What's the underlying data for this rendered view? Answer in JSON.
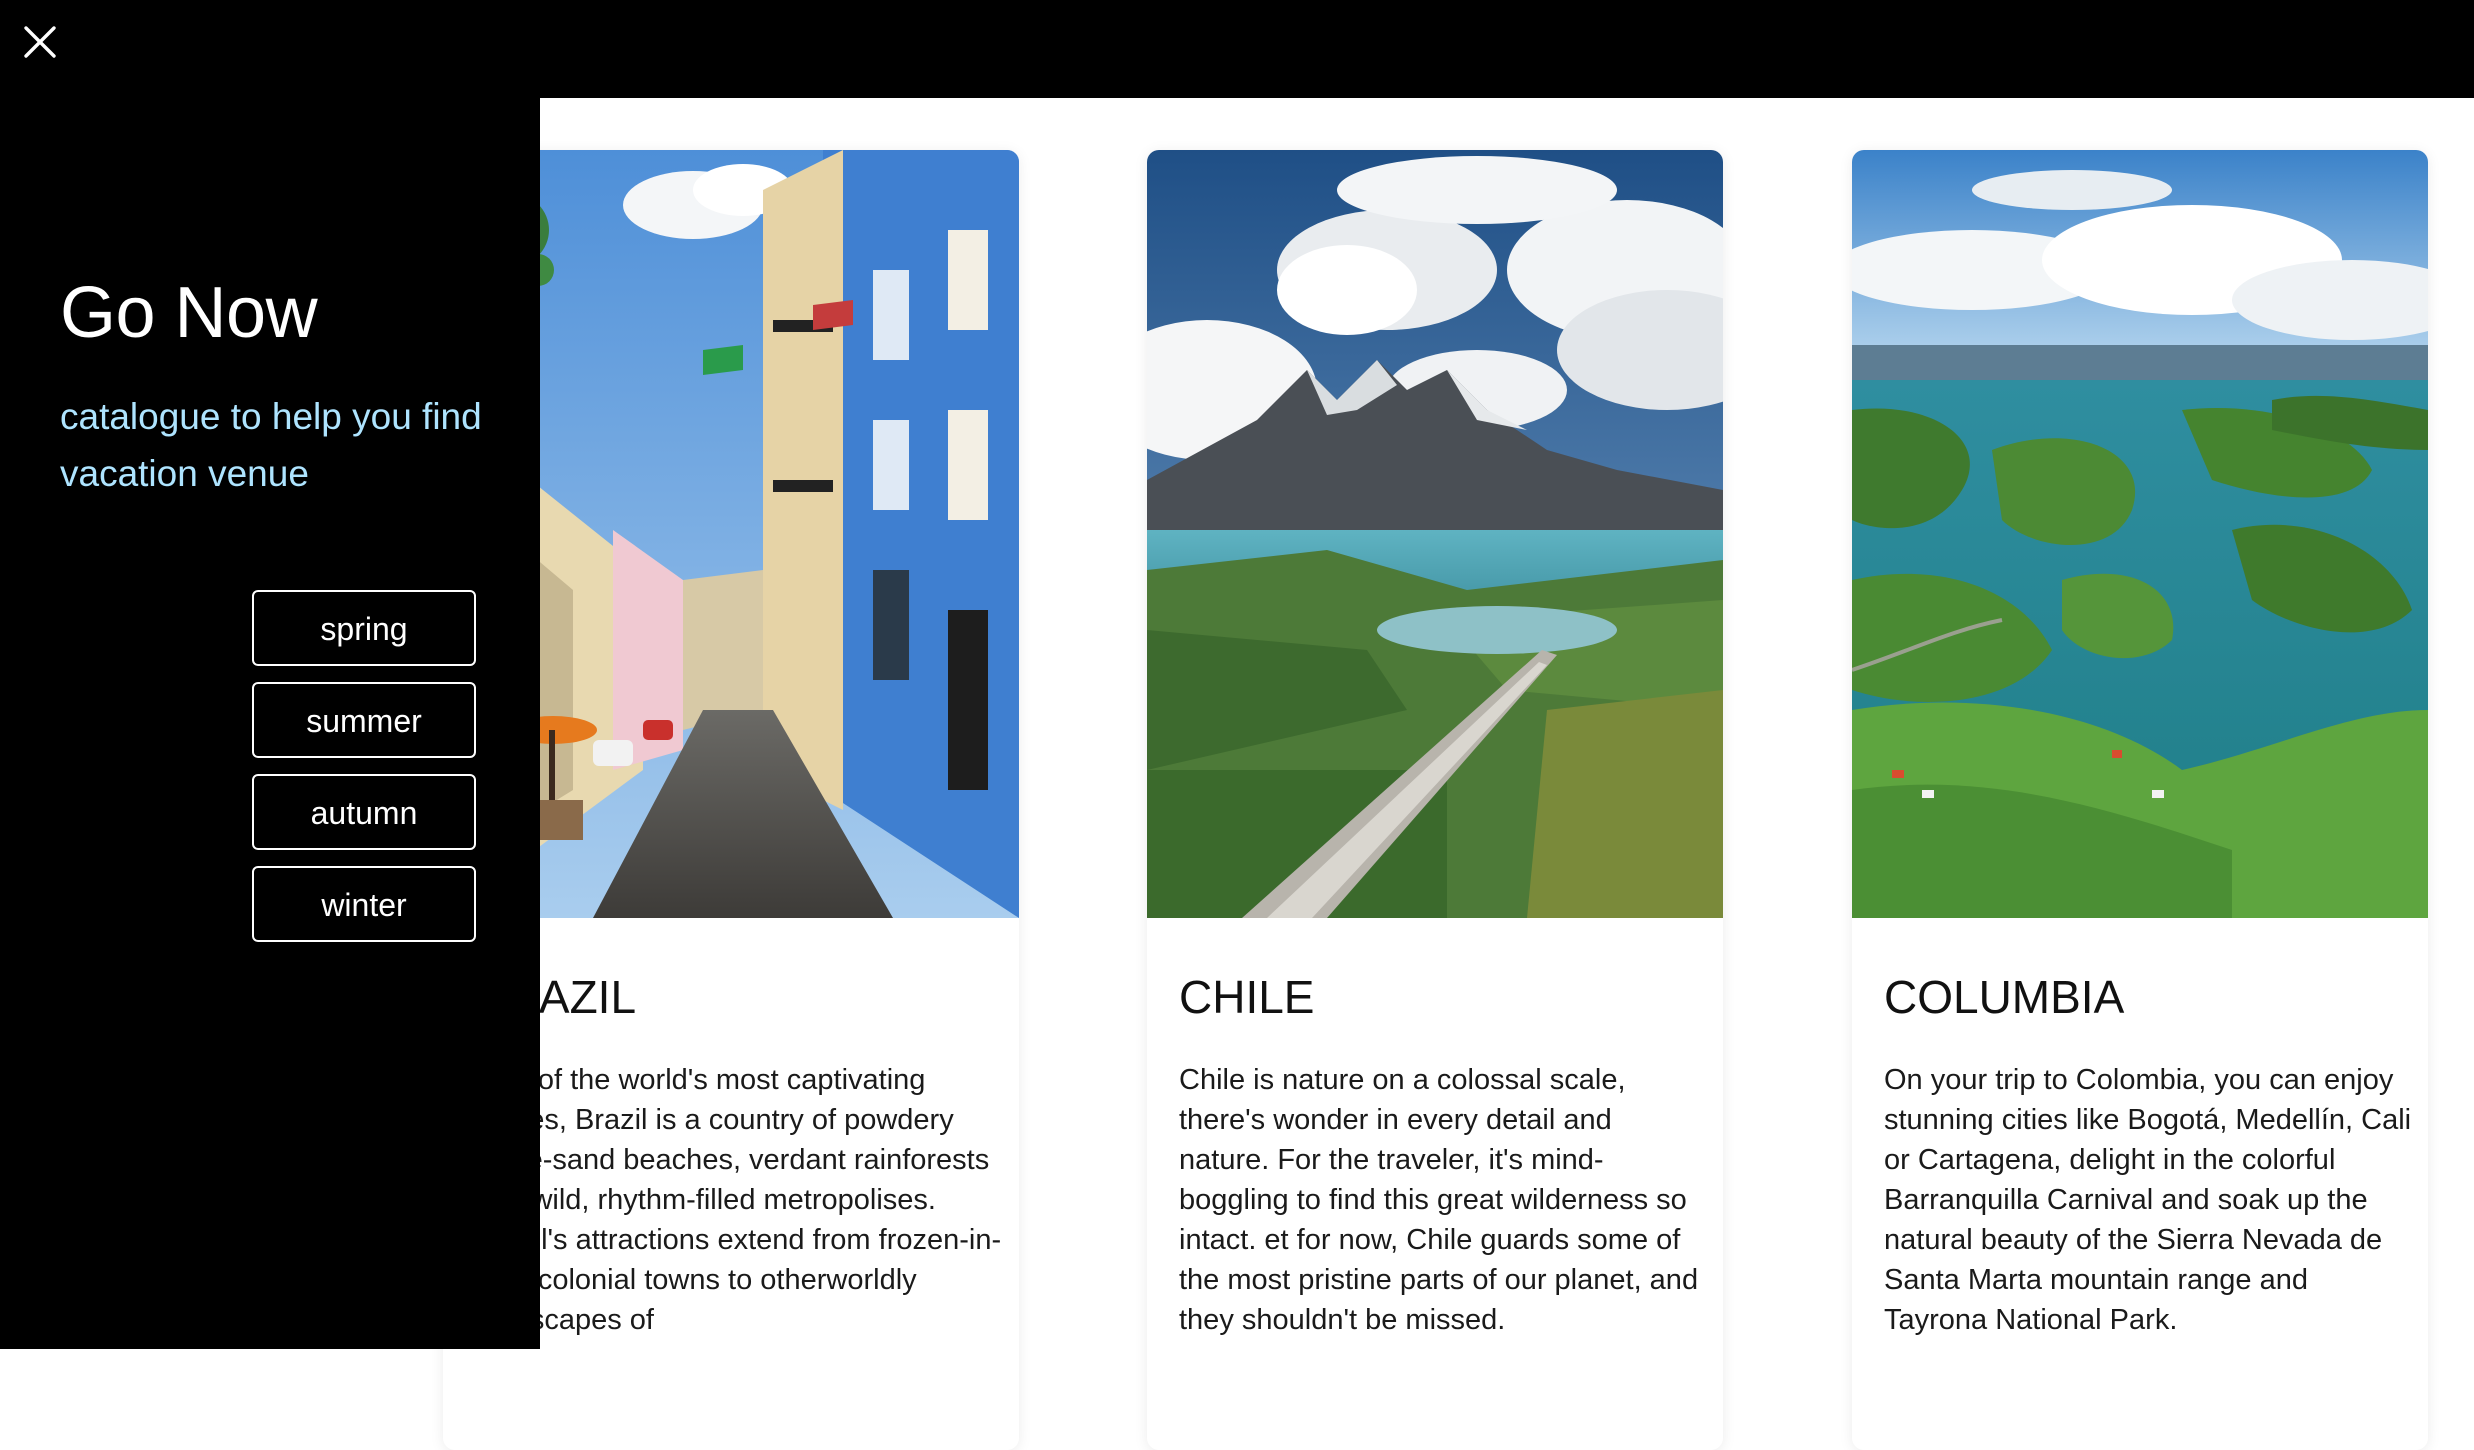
{
  "sidebar": {
    "close_icon": "close-icon",
    "title": "Go Now",
    "subtitle": "catalogue to help you find vacation venue",
    "seasons": [
      "spring",
      "summer",
      "autumn",
      "winter"
    ]
  },
  "cards": [
    {
      "title": "BRAZIL",
      "image_icon": "brazil-street-photo",
      "text": "One of the world's most captivating places, Brazil is a country of powdery white-sand beaches, verdant rainforests and wild, rhythm-filled metropolises. Brazil's attractions extend from frozen-in-time colonial towns to otherworldly landscapes of"
    },
    {
      "title": "CHILE",
      "image_icon": "chile-mountains-photo",
      "text": "Chile is nature on a colossal scale, there's wonder in every detail and nature. For the traveler, it's mind-boggling to find this great wilderness so intact. et for now, Chile guards some of the most pristine parts of our planet, and they shouldn't be missed."
    },
    {
      "title": "COLUMBIA",
      "image_icon": "columbia-lake-photo",
      "text": "On your trip to Colombia, you can enjoy stunning cities like Bogotá, Medellín, Cali or Cartagena, delight in the colorful Barranquilla Carnival and soak up the natural beauty of the Sierra Nevada de Santa Marta mountain range and Tayrona National Park."
    }
  ],
  "colors": {
    "sidebar_bg": "#000000",
    "subtitle_accent": "#aee4ff",
    "card_bg": "#ffffff"
  }
}
